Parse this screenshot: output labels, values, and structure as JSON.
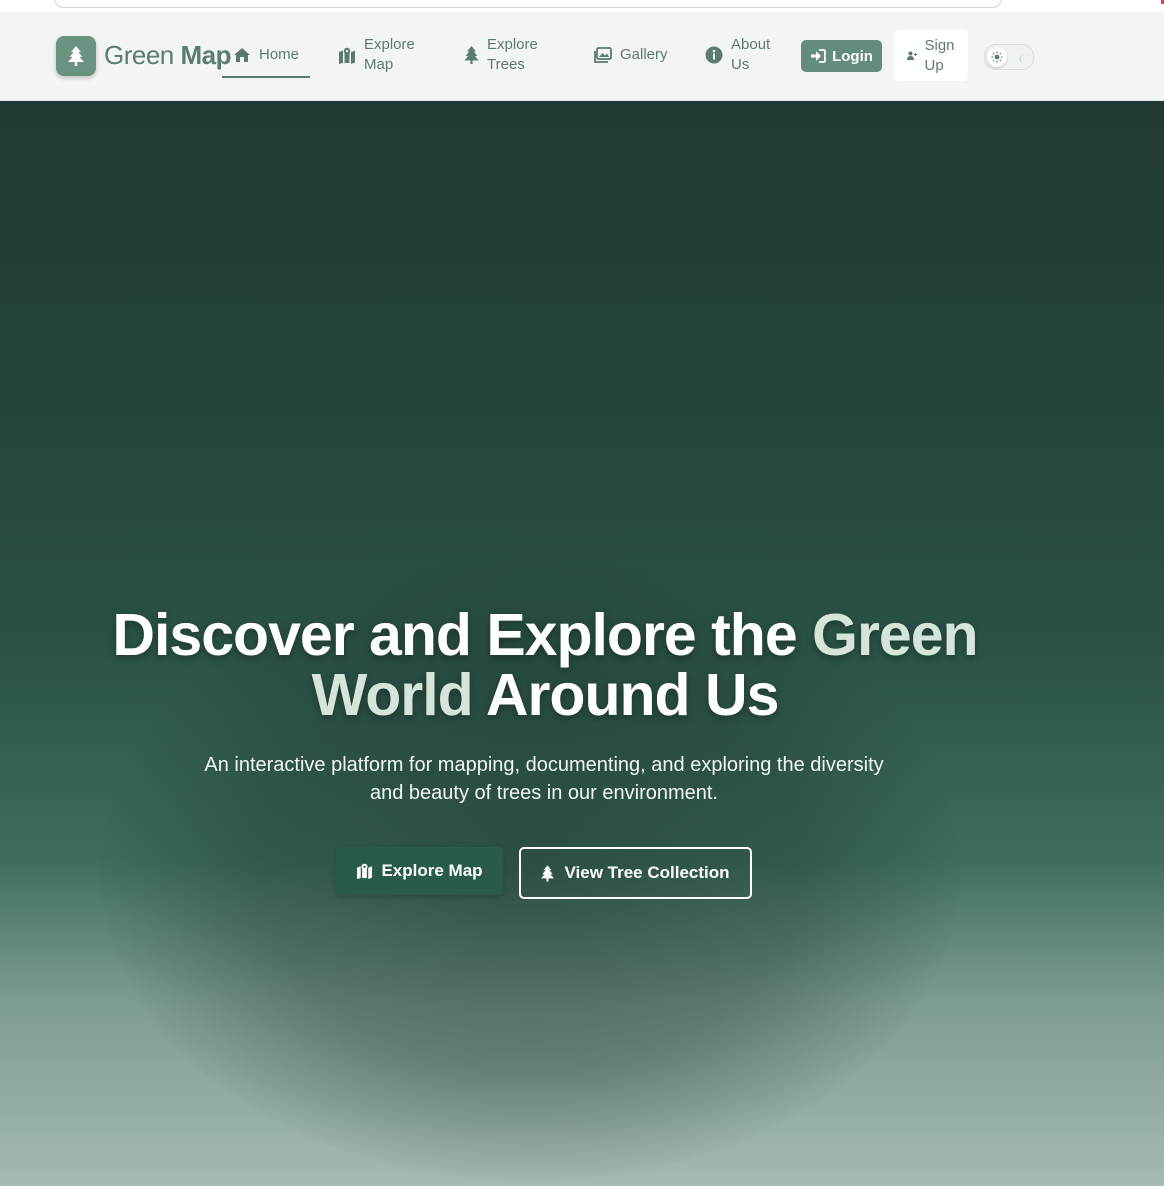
{
  "brand": {
    "name_light": "Green",
    "name_bold": "Map",
    "logo_icon": "tree-icon",
    "accent_color": "#648c7b"
  },
  "nav": {
    "items": [
      {
        "label": "Home",
        "icon": "home-icon",
        "active": true
      },
      {
        "label": "Explore\nMap",
        "icon": "map-icon",
        "active": false
      },
      {
        "label": "Explore\nTrees",
        "icon": "tree-icon",
        "active": false
      },
      {
        "label": "Gallery",
        "icon": "gallery-icon",
        "active": false
      },
      {
        "label": "About\nUs",
        "icon": "info-icon",
        "active": false
      }
    ],
    "login_label": "Login",
    "signup_label": "Sign\nUp",
    "theme_toggle": {
      "icons": [
        "sun-icon",
        "moon-icon"
      ],
      "mode": "light"
    }
  },
  "hero": {
    "title_part1": "Discover and Explore the",
    "title_accent": "Green World",
    "title_part2": "Around Us",
    "subtitle": "An interactive platform for mapping, documenting, and exploring the diversity and beauty of trees in our environment.",
    "primary_button": "Explore Map",
    "secondary_button": "View Tree Collection",
    "colors": {
      "background_top": "#1f3a34",
      "accent_text": "#d6e5d9"
    }
  }
}
